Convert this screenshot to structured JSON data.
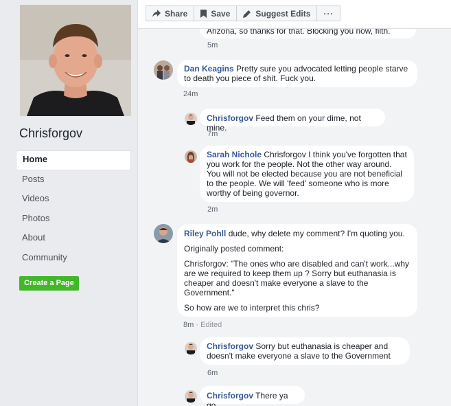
{
  "page": {
    "name": "Chrisforgov",
    "nav": [
      {
        "label": "Home",
        "active": true
      },
      {
        "label": "Posts"
      },
      {
        "label": "Videos"
      },
      {
        "label": "Photos"
      },
      {
        "label": "About"
      },
      {
        "label": "Community"
      }
    ],
    "create_page_label": "Create a Page"
  },
  "toolbar": {
    "share_label": "Share",
    "save_label": "Save",
    "suggest_label": "Suggest Edits",
    "more_label": "···"
  },
  "comments": [
    {
      "text": "Arizona, so thanks for that. Blocking you now, filth.",
      "time": "5m"
    },
    {
      "author": "Dan Keagins",
      "text": "Pretty sure you advocated letting people starve to death you piece of shit. Fuck you.",
      "time": "24m"
    },
    {
      "author": "Chrisforgov",
      "text": "Feed them on your dime, not mine.",
      "time": "7m"
    },
    {
      "author": "Sarah Nichole",
      "text": "Chrisforgov I think you've forgotten that you work for the people. Not the other way around. You will not be elected because you are not beneficial to the people. We will 'feed' someone who is more worthy of being governor.",
      "time": "2m"
    },
    {
      "author": "Riley Pohll",
      "text": "dude, why delete my comment? I'm quoting you.",
      "para2": "Originally posted comment:",
      "para3": "Chrisforgov: \"The ones who are disabled and can't work...why are we required to keep them up ? Sorry but euthanasia is cheaper and doesn't make everyone a slave to the Government.\"",
      "para4": "So how are we to interpret this chris?",
      "time": "8m",
      "edited": "· Edited"
    },
    {
      "author": "Chrisforgov",
      "text": "Sorry but euthanasia is cheaper and doesn't make everyone a slave to the Government",
      "time": "6m"
    },
    {
      "author": "Chrisforgov",
      "text": "There ya go."
    }
  ],
  "colors": {
    "link": "#385898",
    "create_button": "#42b72a",
    "background": "#e9ebee"
  }
}
